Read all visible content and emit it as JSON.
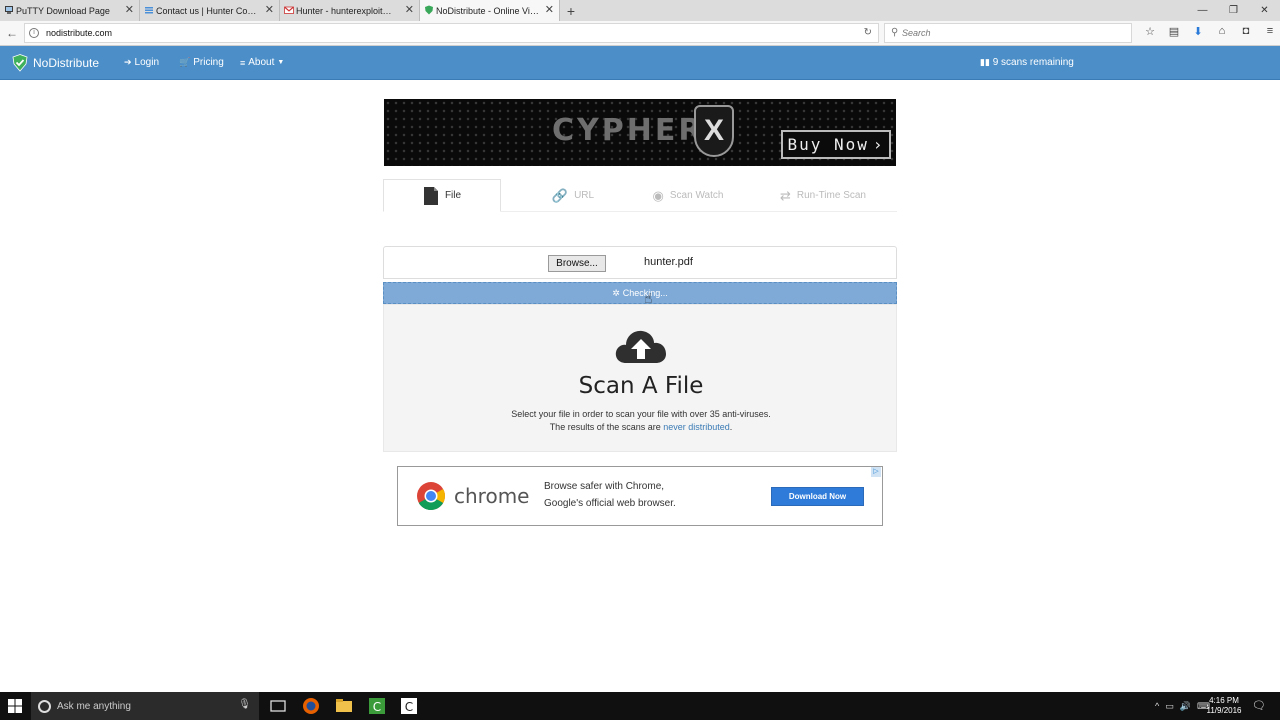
{
  "browser": {
    "tabs": [
      {
        "title": "PuTTY Download Page"
      },
      {
        "title": "Contact us | Hunter Comp..."
      },
      {
        "title": "Hunter - hunterexploit@g..."
      },
      {
        "title": "NoDistribute - Online Viru..."
      }
    ],
    "url": "nodistribute.com",
    "search_placeholder": "Search"
  },
  "site_nav": {
    "brand": "NoDistribute",
    "login": "Login",
    "pricing": "Pricing",
    "about": "About",
    "scans_remaining": "9 scans remaining"
  },
  "banner": {
    "brand_text": "CYPHER",
    "mark": "X",
    "cta": "Buy Now"
  },
  "scan_tabs": [
    {
      "label": "File"
    },
    {
      "label": "URL"
    },
    {
      "label": "Scan Watch"
    },
    {
      "label": "Run-Time Scan"
    }
  ],
  "upload": {
    "browse_label": "Browse...",
    "filename": "hunter.pdf",
    "status": "Checking..."
  },
  "scan_panel": {
    "title": "Scan A File",
    "desc_line1": "Select your file in order to scan your file with over 35 anti-viruses.",
    "desc_line2_prefix": "The results of the scans are ",
    "desc_link": "never distributed",
    "desc_line2_suffix": "."
  },
  "ad": {
    "brand": "chrome",
    "line1": "Browse safer with Chrome,",
    "line2": "Google's official web browser.",
    "button": "Download Now"
  },
  "taskbar": {
    "search_placeholder": "Ask me anything",
    "time": "4:16 PM",
    "date": "11/9/2016"
  },
  "colors": {
    "nav_blue": "#4b8ec8",
    "checking_blue": "#7fa9d6",
    "link_blue": "#3b7bb5",
    "download_btn": "#2f7bd9"
  }
}
